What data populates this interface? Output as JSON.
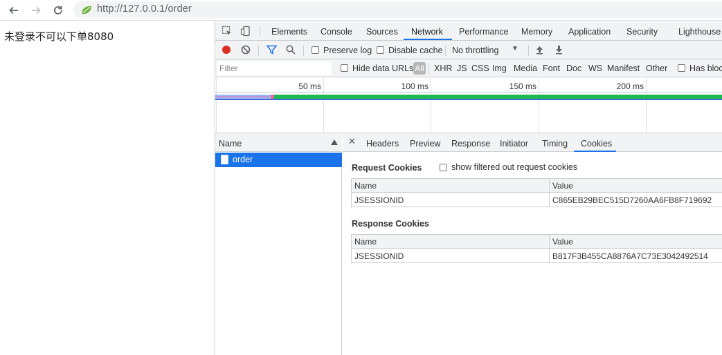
{
  "browser": {
    "url": "http://127.0.0.1/order",
    "site_icon": "spring-leaf-icon",
    "accent_color": "#6db33f"
  },
  "page": {
    "text": "未登录不可以下单8080"
  },
  "devtools": {
    "tabs": [
      "Elements",
      "Console",
      "Sources",
      "Network",
      "Performance",
      "Memory",
      "Application",
      "Security",
      "Lighthouse"
    ],
    "active_tab": "Network",
    "toolbar": {
      "preserve_log": "Preserve log",
      "disable_cache": "Disable cache",
      "throttling": "No throttling"
    },
    "filterbar": {
      "filter_placeholder": "Filter",
      "hide_data_urls": "Hide data URLs",
      "types": [
        "All",
        "XHR",
        "JS",
        "CSS",
        "Img",
        "Media",
        "Font",
        "Doc",
        "WS",
        "Manifest",
        "Other"
      ],
      "has_blocked": "Has block"
    },
    "timeline": {
      "labels": [
        "50 ms",
        "100 ms",
        "150 ms",
        "200 ms"
      ]
    },
    "request_list": {
      "header": "Name",
      "rows": [
        "order"
      ]
    },
    "detail": {
      "tabs": [
        "Headers",
        "Preview",
        "Response",
        "Initiator",
        "Timing",
        "Cookies"
      ],
      "active_tab": "Cookies",
      "request_cookies": {
        "title": "Request Cookies",
        "show_filtered": "show filtered out request cookies",
        "columns": [
          "Name",
          "Value"
        ],
        "rows": [
          [
            "JSESSIONID",
            "C865EB29BEC515D7260AA6FB8F719692"
          ]
        ]
      },
      "response_cookies": {
        "title": "Response Cookies",
        "columns": [
          "Name",
          "Value"
        ],
        "rows": [
          [
            "JSESSIONID",
            "B817F3B455CA8876A7C73E3042492514"
          ]
        ]
      }
    }
  }
}
